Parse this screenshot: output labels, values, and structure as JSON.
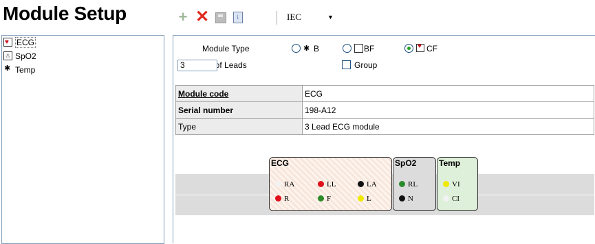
{
  "header": {
    "title": "Module Setup",
    "standard": "IEC"
  },
  "toolbar": {
    "add": "+",
    "delete": "✕",
    "import_glyph": "↓"
  },
  "left_list": {
    "items": [
      {
        "label": "ECG",
        "icon": "cf-heart-icon",
        "selected": true
      },
      {
        "label": "SpO2",
        "icon": "bf-body-icon",
        "selected": false
      },
      {
        "label": "Temp",
        "icon": "b-body-icon",
        "selected": false
      }
    ]
  },
  "form": {
    "module_type_label": "Module Type",
    "leads_label": "No of Leads",
    "leads_value": "3",
    "group_label": "Group",
    "group_checked": false,
    "options": [
      {
        "label": "B",
        "selected": false
      },
      {
        "label": "BF",
        "selected": false
      },
      {
        "label": "CF",
        "selected": true
      }
    ]
  },
  "properties": [
    {
      "key": "Module code",
      "value": "ECG"
    },
    {
      "key": "Serial number",
      "value": "198-A12"
    },
    {
      "key": "Type",
      "value": "3 Lead ECG module"
    }
  ],
  "diagram": {
    "modules": [
      {
        "name": "ECG",
        "leads": [
          {
            "label": "RA",
            "color": "#f2f2f2"
          },
          {
            "label": "LL",
            "color": "#e0101a"
          },
          {
            "label": "LA",
            "color": "#111111"
          },
          {
            "label": "R",
            "color": "#e0101a"
          },
          {
            "label": "F",
            "color": "#2c8a2c"
          },
          {
            "label": "L",
            "color": "#f0e800"
          }
        ]
      },
      {
        "name": "SpO2",
        "leads": [
          {
            "label": "RL",
            "color": "#2c8a2c"
          },
          {
            "label": "N",
            "color": "#111111"
          }
        ]
      },
      {
        "name": "Temp",
        "leads": [
          {
            "label": "VI",
            "color": "#f0e800"
          },
          {
            "label": "CI",
            "color": "#f2f2f2"
          }
        ]
      }
    ]
  }
}
